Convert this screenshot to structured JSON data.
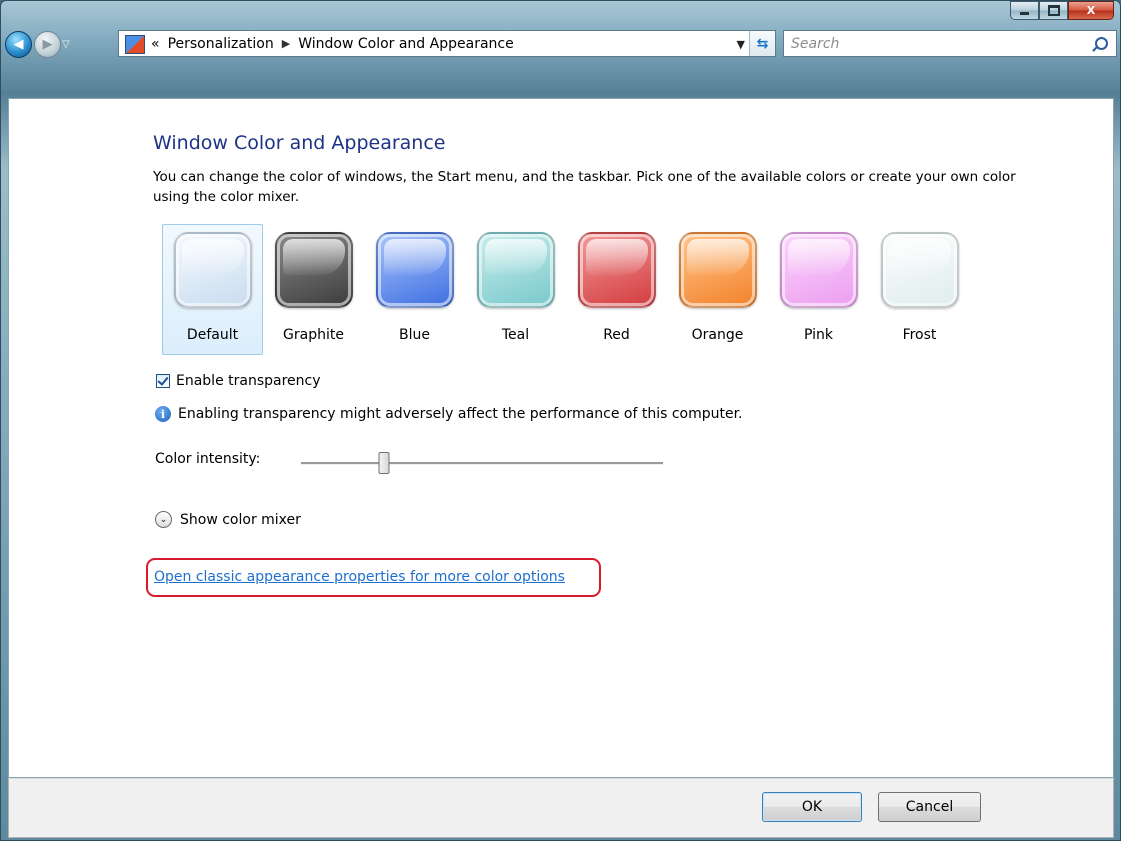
{
  "window": {
    "controls": {
      "minimize_icon": "minimize-icon",
      "maximize_icon": "maximize-icon",
      "close_glyph": "X"
    }
  },
  "nav": {
    "back_glyph": "◀",
    "forward_glyph": "▶",
    "recent_glyph": "▽",
    "address": {
      "overflow": "«",
      "breadcrumbs": [
        "Personalization",
        "Window Color and Appearance"
      ],
      "separator": "▶",
      "dropdown_glyph": "▼",
      "refresh_glyph": "⁴⁄₄"
    },
    "search": {
      "placeholder": "Search",
      "value": ""
    }
  },
  "main": {
    "title": "Window Color and Appearance",
    "description": "You can change the color of windows, the Start menu, and the taskbar. Pick one of the available colors or create your own color using the color mixer.",
    "swatches": [
      {
        "label": "Default",
        "color_top": "#f4f9ff",
        "color_bottom": "#c9dcef",
        "selected": true
      },
      {
        "label": "Graphite",
        "color_top": "#8a8a8a",
        "color_bottom": "#3c3c3c",
        "selected": false
      },
      {
        "label": "Blue",
        "color_top": "#a9c4fb",
        "color_bottom": "#3e6fe1",
        "selected": false
      },
      {
        "label": "Teal",
        "color_top": "#c7ecec",
        "color_bottom": "#79c9cb",
        "selected": false
      },
      {
        "label": "Red",
        "color_top": "#f39a9a",
        "color_bottom": "#d23b3e",
        "selected": false
      },
      {
        "label": "Orange",
        "color_top": "#ffc48a",
        "color_bottom": "#f3822b",
        "selected": false
      },
      {
        "label": "Pink",
        "color_top": "#fbd3fb",
        "color_bottom": "#ec9ef0",
        "selected": false
      },
      {
        "label": "Frost",
        "color_top": "#fbfdfd",
        "color_bottom": "#dfeced",
        "selected": false
      }
    ],
    "transparency": {
      "label": "Enable transparency",
      "checked": true
    },
    "info_text": "Enabling transparency might adversely affect the performance of this computer.",
    "info_glyph": "i",
    "intensity": {
      "label": "Color intensity:",
      "value_fraction": 0.23
    },
    "mixer": {
      "label": "Show color mixer",
      "glyph": "⌄"
    },
    "classic_link": "Open classic appearance properties for more color options",
    "highlight_color": "#d9192c"
  },
  "footer": {
    "ok_label": "OK",
    "cancel_label": "Cancel"
  }
}
